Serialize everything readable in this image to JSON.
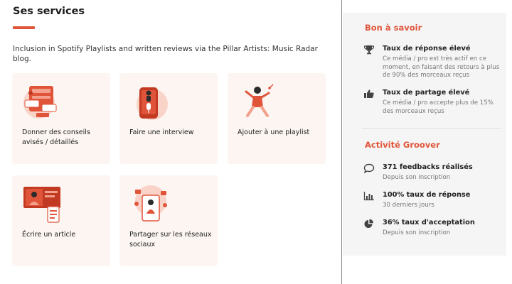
{
  "services": {
    "title": "Ses services",
    "description": "Inclusion in Spotify Playlists and written reviews via the Pillar Artists: Music Radar blog.",
    "cards": [
      {
        "label": "Donner des conseils avisés / détaillés",
        "icon": "advice-illustration"
      },
      {
        "label": "Faire une interview",
        "icon": "interview-illustration"
      },
      {
        "label": "Ajouter à une playlist",
        "icon": "playlist-illustration"
      },
      {
        "label": "Écrire un article",
        "icon": "article-illustration"
      },
      {
        "label": "Partager sur les réseaux sociaux",
        "icon": "social-share-illustration"
      }
    ]
  },
  "sidebar": {
    "good_to_know": {
      "title": "Bon à savoir",
      "items": [
        {
          "title": "Taux de réponse élevé",
          "subtitle": "Ce média / pro est très actif en ce moment, en faisant des retours à plus de 90% des morceaux reçus",
          "icon": "trophy-icon"
        },
        {
          "title": "Taux de partage élevé",
          "subtitle": "Ce média / pro accepte plus de 15% des morceaux reçus",
          "icon": "thumbs-up-icon"
        }
      ]
    },
    "activity": {
      "title": "Activité Groover",
      "items": [
        {
          "title": "371 feedbacks réalisés",
          "subtitle": "Depuis son inscription",
          "icon": "comment-icon"
        },
        {
          "title": "100% taux de réponse",
          "subtitle": "30 derniers jours",
          "icon": "bar-chart-icon"
        },
        {
          "title": "36% taux d'acceptation",
          "subtitle": "Depuis son inscription",
          "icon": "pie-chart-icon"
        }
      ]
    }
  },
  "colors": {
    "accent": "#e0553a",
    "card_bg": "#fcf5f2",
    "sidebar_bg": "#f5f5f5"
  }
}
